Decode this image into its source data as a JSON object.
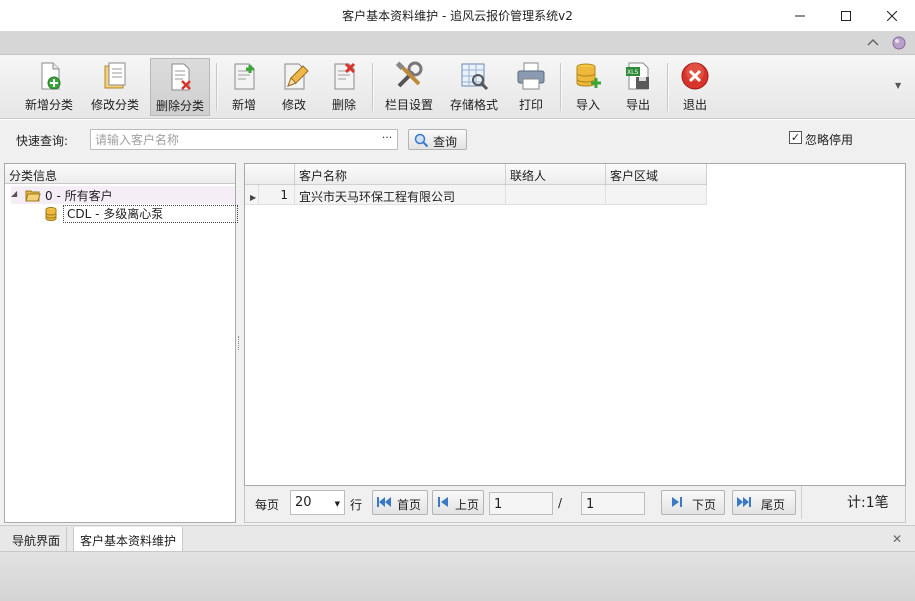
{
  "window": {
    "title": "客户基本资料维护 - 追风云报价管理系统v2"
  },
  "toolbar": {
    "buttons": [
      {
        "label": "新增分类",
        "icon": "add-category-icon"
      },
      {
        "label": "修改分类",
        "icon": "edit-category-icon"
      },
      {
        "label": "删除分类",
        "icon": "delete-category-icon",
        "pressed": true
      },
      {
        "label": "新增",
        "icon": "add-document-icon"
      },
      {
        "label": "修改",
        "icon": "edit-pencil-icon"
      },
      {
        "label": "删除",
        "icon": "delete-document-icon"
      },
      {
        "label": "栏目设置",
        "icon": "tools-icon"
      },
      {
        "label": "存储格式",
        "icon": "save-format-icon"
      },
      {
        "label": "打印",
        "icon": "printer-icon"
      },
      {
        "label": "导入",
        "icon": "import-database-icon"
      },
      {
        "label": "导出",
        "icon": "export-excel-icon"
      },
      {
        "label": "退出",
        "icon": "exit-icon"
      }
    ]
  },
  "search": {
    "label": "快速查询:",
    "placeholder": "请输入客户名称",
    "ellipsis": "···",
    "button_label": "查询",
    "ignore_label": "忽略停用",
    "ignore_checked": true
  },
  "category_panel": {
    "header": "分类信息",
    "tree": [
      {
        "label": "0 - 所有客户",
        "expanded": true,
        "children": [
          {
            "label": "CDL - 多级离心泵"
          }
        ]
      }
    ]
  },
  "grid": {
    "columns": [
      "",
      "客户名称",
      "联络人",
      "客户区域"
    ],
    "rows": [
      {
        "index": "1",
        "name": "宜兴市天马环保工程有限公司",
        "contact": "",
        "region": ""
      }
    ]
  },
  "pager": {
    "per_page_label": "每页",
    "per_page_value": "20",
    "rows_label": "行",
    "first_label": "首页",
    "prev_label": "上页",
    "current_page": "1",
    "slash": "/",
    "total_pages": "1",
    "next_label": "下页",
    "last_label": "尾页",
    "count_text": "计:1笔"
  },
  "tabs": [
    {
      "label": "导航界面",
      "active": false
    },
    {
      "label": "客户基本资料维护",
      "active": true
    }
  ],
  "colors": {
    "accent_blue": "#3a78c8",
    "exit_red": "#d9342b",
    "add_green": "#3aa63a"
  }
}
